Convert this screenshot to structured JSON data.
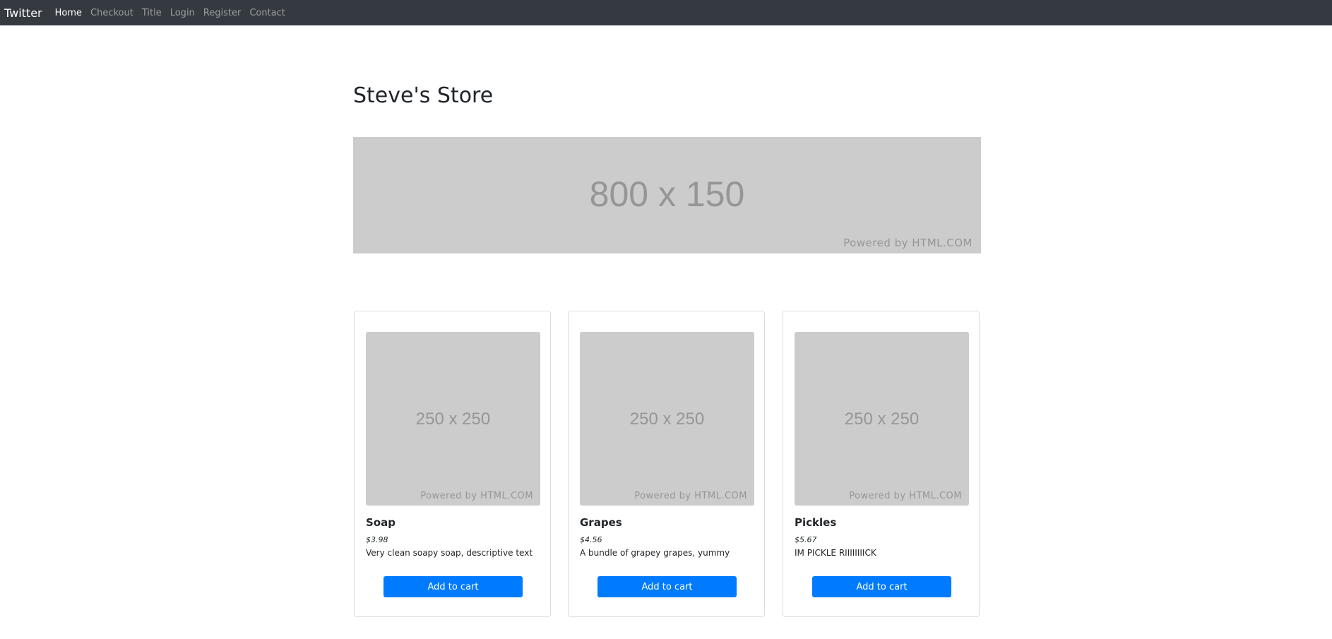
{
  "nav": {
    "brand": "Twitter",
    "links": [
      "Home",
      "Checkout",
      "Title",
      "Login",
      "Register",
      "Contact"
    ]
  },
  "title": "Steve's Store",
  "banner": {
    "size": "800 x 150",
    "powered": "Powered by HTML.COM"
  },
  "products": [
    {
      "name": "Soap",
      "price": "$3.98",
      "desc": "Very clean soapy soap, descriptive text",
      "img": "250 x 250",
      "powered": "Powered by HTML.COM",
      "button": "Add to cart"
    },
    {
      "name": "Grapes",
      "price": "$4.56",
      "desc": "A bundle of grapey grapes, yummy",
      "img": "250 x 250",
      "powered": "Powered by HTML.COM",
      "button": "Add to cart"
    },
    {
      "name": "Pickles",
      "price": "$5.67",
      "desc": "IM PICKLE RIIIIIIIICK",
      "img": "250 x 250",
      "powered": "Powered by HTML.COM",
      "button": "Add to cart"
    }
  ]
}
